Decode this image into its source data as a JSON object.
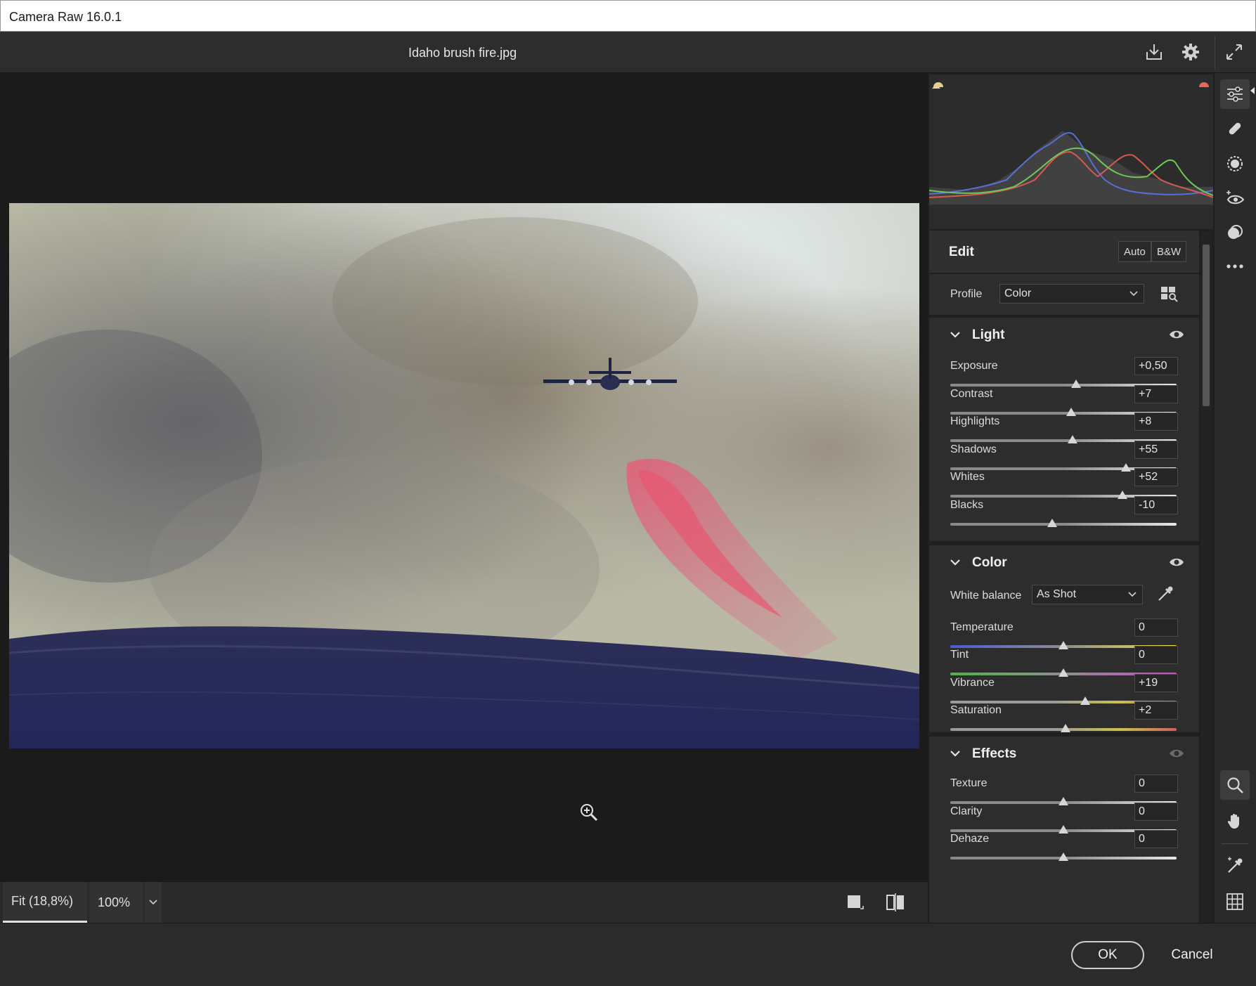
{
  "window": {
    "title": "Camera Raw 16.0.1"
  },
  "header": {
    "filename": "Idaho brush fire.jpg",
    "icons": [
      "save-download-icon",
      "gear-icon",
      "fullscreen-icon"
    ]
  },
  "preview": {
    "zoom_fit_label": "Fit (18,8%)",
    "zoom_100_label": "100%"
  },
  "edit": {
    "title": "Edit",
    "auto_label": "Auto",
    "bw_label": "B&W",
    "profile_label": "Profile",
    "profile_value": "Color"
  },
  "light": {
    "title": "Light",
    "sliders": [
      {
        "label": "Exposure",
        "value": "+0,50",
        "position": 0.555
      },
      {
        "label": "Contrast",
        "value": "+7",
        "position": 0.535
      },
      {
        "label": "Highlights",
        "value": "+8",
        "position": 0.54
      },
      {
        "label": "Shadows",
        "value": "+55",
        "position": 0.775
      },
      {
        "label": "Whites",
        "value": "+52",
        "position": 0.76
      },
      {
        "label": "Blacks",
        "value": "-10",
        "position": 0.45
      }
    ]
  },
  "color": {
    "title": "Color",
    "wb_label": "White balance",
    "wb_value": "As Shot",
    "sliders": [
      {
        "label": "Temperature",
        "value": "0",
        "position": 0.5
      },
      {
        "label": "Tint",
        "value": "0",
        "position": 0.5
      },
      {
        "label": "Vibrance",
        "value": "+19",
        "position": 0.595
      },
      {
        "label": "Saturation",
        "value": "+2",
        "position": 0.51
      }
    ]
  },
  "effects": {
    "title": "Effects",
    "sliders": [
      {
        "label": "Texture",
        "value": "0",
        "position": 0.5
      },
      {
        "label": "Clarity",
        "value": "0",
        "position": 0.5
      },
      {
        "label": "Dehaze",
        "value": "0",
        "position": 0.5
      }
    ]
  },
  "footer": {
    "ok_label": "OK",
    "cancel_label": "Cancel"
  },
  "colors": {
    "panel": "#2d2d2d",
    "preview_bg": "#1b1b1b",
    "accent_text": "#f0f0f0"
  }
}
